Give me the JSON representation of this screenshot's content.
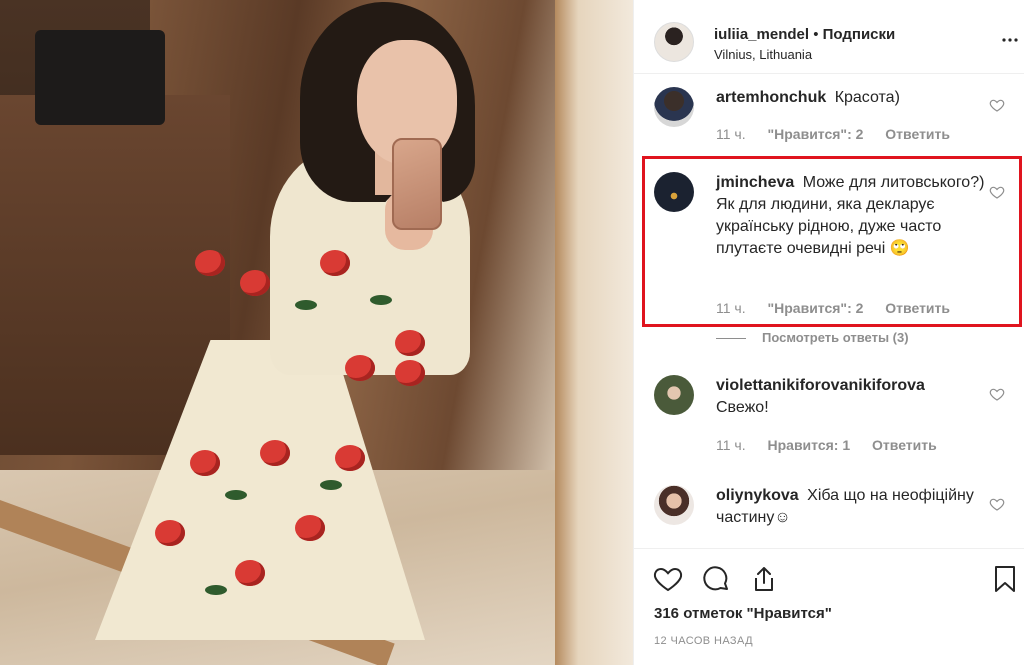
{
  "header": {
    "username": "iuliia_mendel",
    "separator": "•",
    "follow_label": "Подписки",
    "location": "Vilnius, Lithuania",
    "more_icon": "more-horizontal-icon"
  },
  "comments": [
    {
      "username": "artemhonchuk",
      "text": "Красота)",
      "time": "11 ч.",
      "likes": "\"Нравится\": 2",
      "reply_label": "Ответить"
    },
    {
      "username": "jmincheva",
      "text": "Може для литовського?) Як для людини, яка декларує українську рідною, дуже часто плутаєте очевидні речі 🙄",
      "time": "11 ч.",
      "likes": "\"Нравится\": 2",
      "reply_label": "Ответить",
      "view_replies": "Посмотреть ответы (3)"
    },
    {
      "username": "violettanikiforovanikiforova",
      "text": "Свежо!",
      "time": "11 ч.",
      "likes": "Нравится: 1",
      "reply_label": "Ответить"
    },
    {
      "username": "oliynykova",
      "text": "Хіба що на неофіційну частину☺",
      "time": "",
      "likes": "",
      "reply_label": ""
    }
  ],
  "actions": {
    "like_icon": "heart-icon",
    "comment_icon": "comment-icon",
    "share_icon": "share-icon",
    "save_icon": "bookmark-icon"
  },
  "likes_count": "316 отметок \"Нравится\"",
  "timestamp": "12 ЧАСОВ НАЗАД",
  "colors": {
    "highlight_border": "#e0141e",
    "text_primary": "#262626",
    "text_secondary": "#8e8e8e"
  }
}
